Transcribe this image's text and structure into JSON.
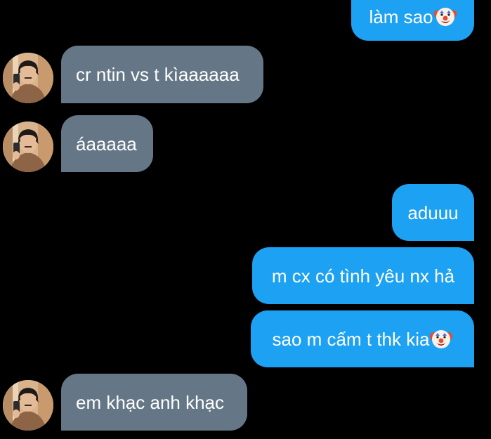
{
  "conversation": {
    "messages": [
      {
        "direction": "sent",
        "text": "làm sao",
        "emoji": "clown-face-icon"
      },
      {
        "direction": "received",
        "text": "cr ntin vs t kìaaaaaa"
      },
      {
        "direction": "received",
        "text": "áaaaaa"
      },
      {
        "direction": "sent",
        "text": "aduuu"
      },
      {
        "direction": "sent",
        "text": "m cx có tình yêu nx hả"
      },
      {
        "direction": "sent",
        "text": "sao m cấm t thk kia",
        "emoji": "clown-face-icon"
      },
      {
        "direction": "received",
        "text": "em khạc anh khạc"
      }
    ]
  },
  "colors": {
    "background": "#000000",
    "sent_bubble": "#1da1f2",
    "received_bubble": "#657786",
    "bubble_text": "#ffffff"
  }
}
